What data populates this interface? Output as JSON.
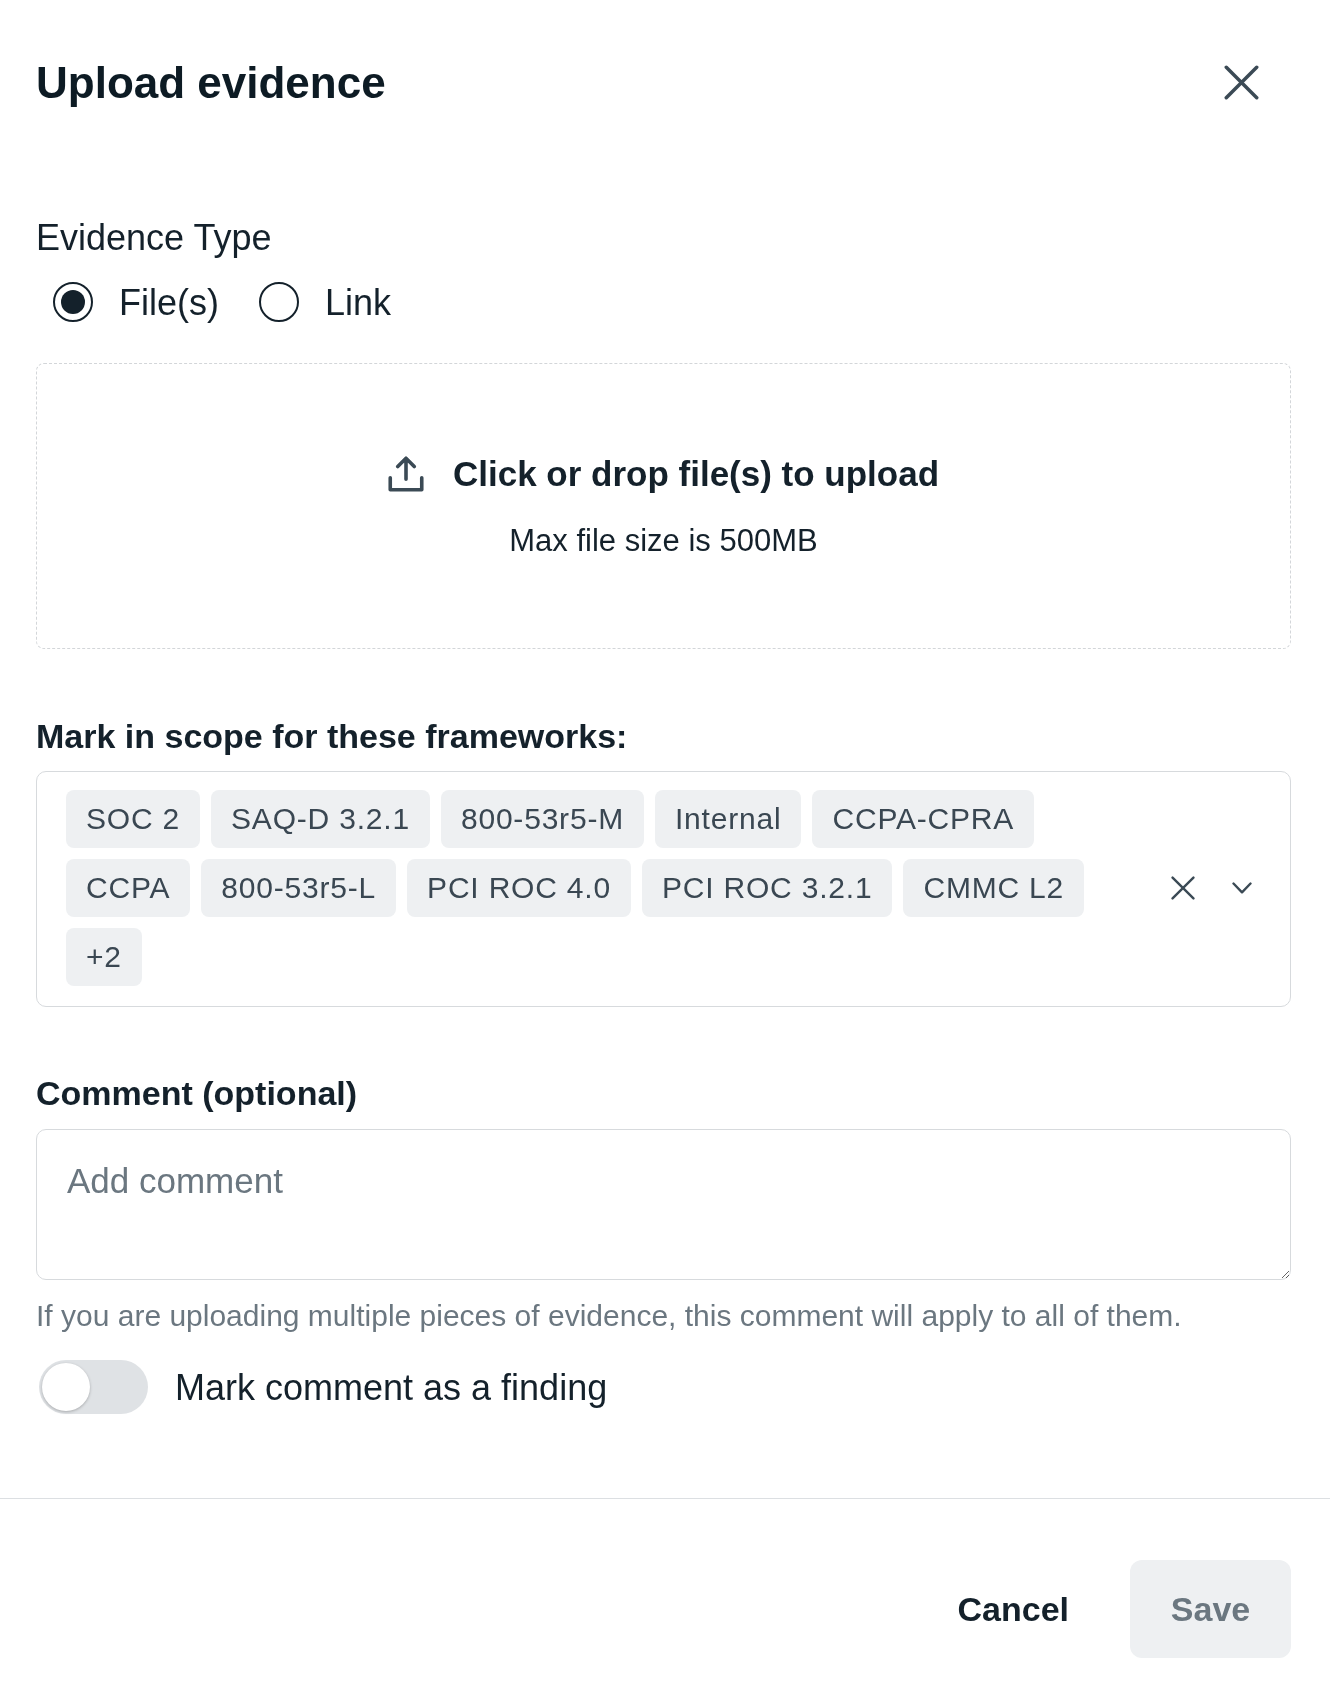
{
  "dialog": {
    "title": "Upload evidence"
  },
  "evidence_type": {
    "label": "Evidence Type",
    "options": [
      {
        "label": "File(s)",
        "selected": true
      },
      {
        "label": "Link",
        "selected": false
      }
    ]
  },
  "dropzone": {
    "text": "Click or drop file(s) to upload",
    "hint": "Max file size is 500MB"
  },
  "frameworks": {
    "label": "Mark in scope for these frameworks:",
    "tags": [
      "SOC 2",
      "SAQ-D 3.2.1",
      "800-53r5-M",
      "Internal",
      "CCPA-CPRA",
      "CCPA",
      "800-53r5-L",
      "PCI ROC 4.0",
      "PCI ROC 3.2.1",
      "CMMC L2"
    ],
    "more": "+2"
  },
  "comment": {
    "label": "Comment (optional)",
    "placeholder": "Add comment",
    "help": "If you are uploading multiple pieces of evidence, this comment will apply to all of them."
  },
  "finding_toggle": {
    "label": "Mark comment as a finding",
    "on": false
  },
  "footer": {
    "cancel": {
      "label": "Cancel"
    },
    "save": {
      "label": "Save",
      "disabled": true
    }
  }
}
